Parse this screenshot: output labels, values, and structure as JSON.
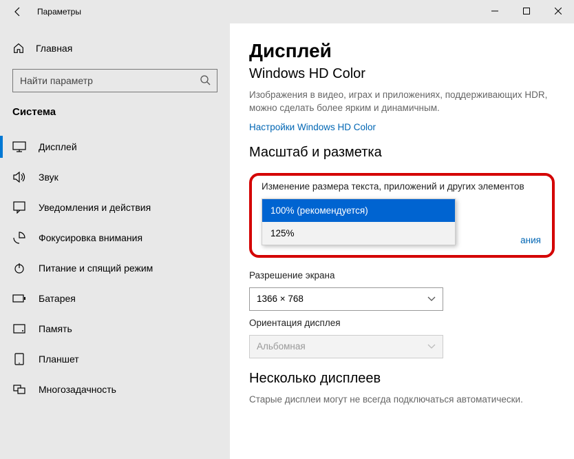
{
  "titlebar": {
    "title": "Параметры"
  },
  "sidebar": {
    "home": "Главная",
    "search_placeholder": "Найти параметр",
    "category": "Система",
    "items": [
      {
        "id": "display",
        "label": "Дисплей",
        "active": true
      },
      {
        "id": "sound",
        "label": "Звук"
      },
      {
        "id": "notifications",
        "label": "Уведомления и действия"
      },
      {
        "id": "focus",
        "label": "Фокусировка внимания"
      },
      {
        "id": "power",
        "label": "Питание и спящий режим"
      },
      {
        "id": "battery",
        "label": "Батарея"
      },
      {
        "id": "storage",
        "label": "Память"
      },
      {
        "id": "tablet",
        "label": "Планшет"
      },
      {
        "id": "multitask",
        "label": "Многозадачность"
      }
    ]
  },
  "content": {
    "heading": "Дисплей",
    "hdcolor_title": "Windows HD Color",
    "hdcolor_desc": "Изображения в видео, играх и приложениях, поддерживающих HDR, можно сделать более ярким и динамичным.",
    "hdcolor_link": "Настройки Windows HD Color",
    "scale_title": "Масштаб и разметка",
    "scale_label": "Изменение размера текста, приложений и других элементов",
    "scale_options": {
      "opt_100": "100% (рекомендуется)",
      "opt_125": "125%"
    },
    "advanced_scaling_partial": "ания",
    "resolution_label": "Разрешение экрана",
    "resolution_value": "1366 × 768",
    "orientation_label": "Ориентация дисплея",
    "orientation_value": "Альбомная",
    "multi_title": "Несколько дисплеев",
    "multi_desc": "Старые дисплеи могут не всегда подключаться автоматически."
  }
}
